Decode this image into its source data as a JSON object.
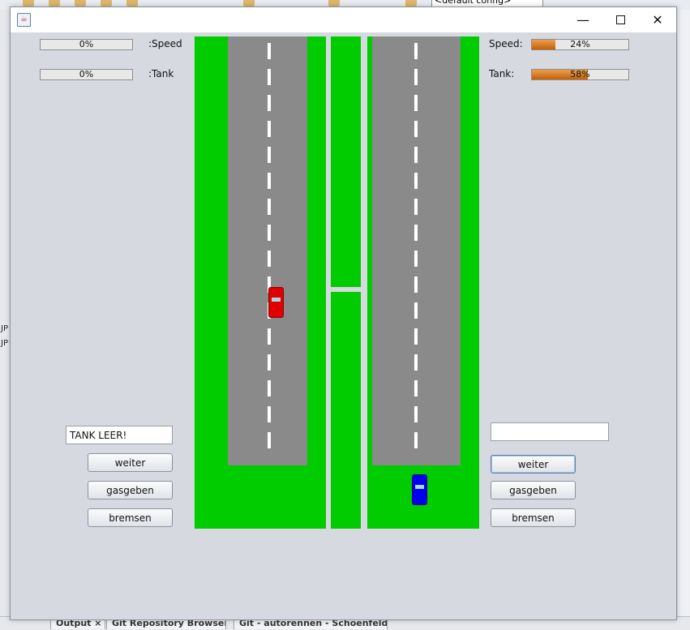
{
  "background_ide": {
    "run_config": "<default config>",
    "left_labels": [
      "JP",
      "JP"
    ],
    "bottom_tabs": [
      "Output ×",
      "Git Repository Browser",
      "Git - autorennen - Schoenfeld"
    ]
  },
  "window": {
    "icon": "java-cup-icon",
    "controls": {
      "minimize": "—",
      "close": "✕"
    }
  },
  "left_player": {
    "speed": {
      "label": ":Speed",
      "value": 0,
      "text": "0%"
    },
    "tank": {
      "label": ":Tank",
      "value": 0,
      "text": "0%"
    },
    "status_field": "TANK LEER!",
    "buttons": {
      "weiter": "weiter",
      "gasgeben": "gasgeben",
      "bremsen": "bremsen"
    }
  },
  "right_player": {
    "speed": {
      "label": "Speed:",
      "value": 24,
      "text": "24%"
    },
    "tank": {
      "label": "Tank:",
      "value": 58,
      "text": "58%"
    },
    "status_field": "",
    "buttons": {
      "weiter": "weiter",
      "gasgeben": "gasgeben",
      "bremsen": "bremsen"
    }
  },
  "colors": {
    "grass": "#00cc00",
    "asphalt": "#8a8a8a",
    "progress_fill": "#d9782a",
    "car_left": "#e00000",
    "car_right": "#0000ee"
  }
}
